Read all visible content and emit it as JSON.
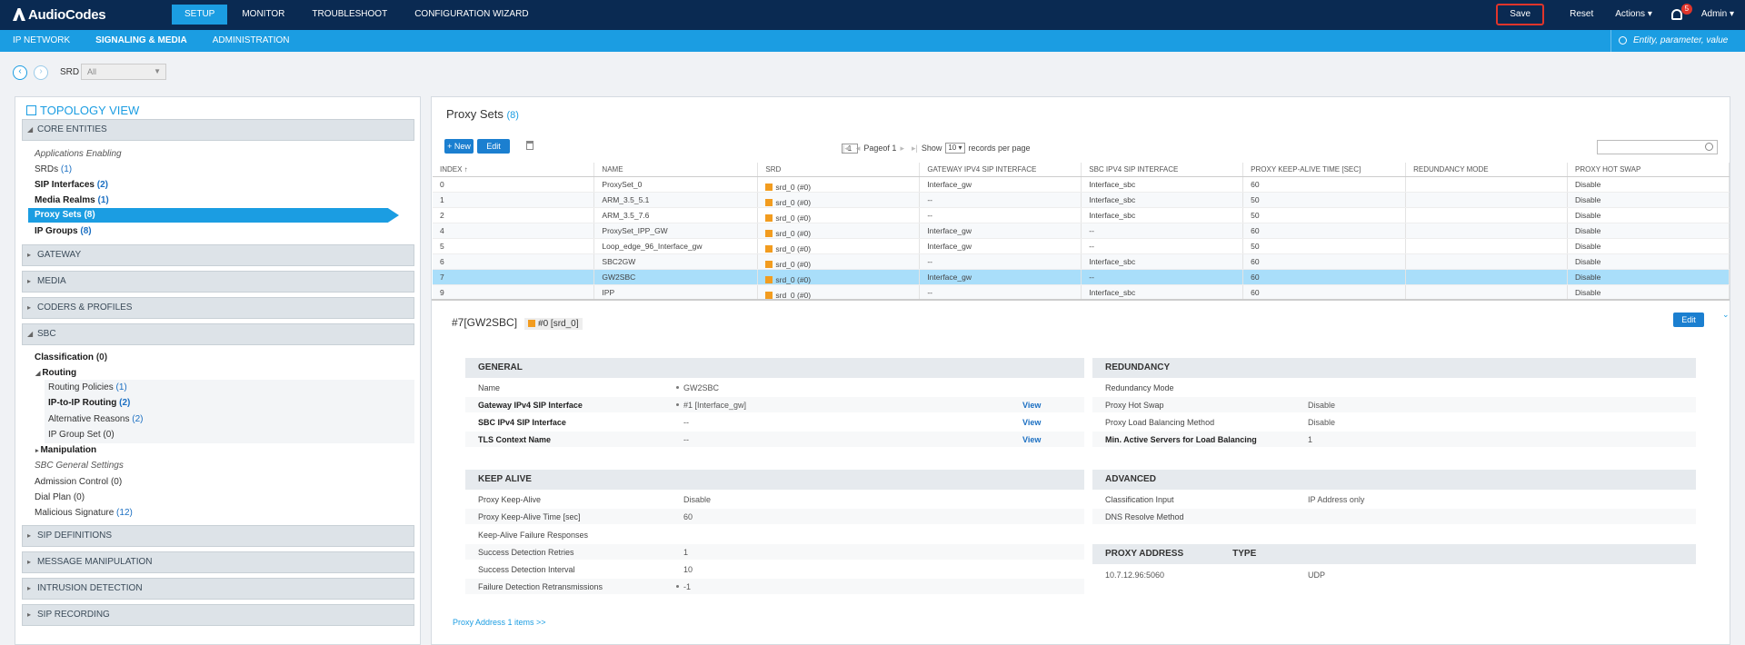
{
  "brand": "AudioCodes",
  "top_nav": [
    "SETUP",
    "MONITOR",
    "TROUBLESHOOT",
    "CONFIGURATION WIZARD"
  ],
  "top_right": {
    "save": "Save",
    "reset": "Reset",
    "actions": "Actions ▾",
    "notifications": "5",
    "user": "Admin ▾"
  },
  "sub_nav": [
    "IP NETWORK",
    "SIGNALING & MEDIA",
    "ADMINISTRATION"
  ],
  "search_placeholder": "Entity, parameter, value",
  "srd": {
    "label": "SRD",
    "value": "All"
  },
  "topology": {
    "title": "TOPOLOGY VIEW",
    "sections": {
      "core": "CORE ENTITIES",
      "gateway": "GATEWAY",
      "media": "MEDIA",
      "codecs": "CODERS & PROFILES",
      "sbc": "SBC",
      "sipdef": "SIP DEFINITIONS",
      "msgman": "MESSAGE MANIPULATION",
      "intrusion": "INTRUSION DETECTION",
      "siprec": "SIP RECORDING"
    },
    "core_items": {
      "app_enabling": "Applications Enabling",
      "srds": "SRDs",
      "srds_cnt": "(1)",
      "sip_interfaces": "SIP Interfaces",
      "sip_interfaces_cnt": "(2)",
      "media_realms": "Media Realms",
      "media_realms_cnt": "(1)",
      "proxy_sets": "Proxy Sets (8)",
      "ip_groups": "IP Groups",
      "ip_groups_cnt": "(8)"
    },
    "sbc_items": {
      "classification": "Classification",
      "classification_cnt": "(0)",
      "routing": "Routing",
      "routing_policies": "Routing Policies",
      "routing_policies_cnt": "(1)",
      "ip_to_ip": "IP-to-IP Routing",
      "ip_to_ip_cnt": "(2)",
      "alt_reasons": "Alternative Reasons",
      "alt_reasons_cnt": "(2)",
      "ip_group_set": "IP Group Set",
      "ip_group_set_cnt": "(0)",
      "manipulation": "Manipulation",
      "general_settings": "SBC General Settings",
      "admission": "Admission Control",
      "admission_cnt": "(0)",
      "dial_plan": "Dial Plan",
      "dial_plan_cnt": "(0)",
      "malicious": "Malicious Signature",
      "malicious_cnt": "(12)"
    }
  },
  "proxy_sets": {
    "title": "Proxy Sets",
    "count": "(8)",
    "buttons": {
      "new": "+ New",
      "edit": "Edit"
    },
    "pager": {
      "page_label": "Page",
      "page": "1",
      "of": "of 1",
      "show": "Show",
      "per_page": "10",
      "records": "records per page"
    },
    "columns": [
      "INDEX ↑",
      "NAME",
      "SRD",
      "GATEWAY IPV4 SIP INTERFACE",
      "SBC IPV4 SIP INTERFACE",
      "PROXY KEEP-ALIVE TIME [SEC]",
      "REDUNDANCY MODE",
      "PROXY HOT SWAP"
    ],
    "rows": [
      [
        "0",
        "ProxySet_0",
        "srd_0 (#0)",
        "Interface_gw",
        "Interface_sbc",
        "60",
        "",
        "Disable"
      ],
      [
        "1",
        "ARM_3.5_5.1",
        "srd_0 (#0)",
        "--",
        "Interface_sbc",
        "50",
        "",
        "Disable"
      ],
      [
        "2",
        "ARM_3.5_7.6",
        "srd_0 (#0)",
        "--",
        "Interface_sbc",
        "50",
        "",
        "Disable"
      ],
      [
        "4",
        "ProxySet_IPP_GW",
        "srd_0 (#0)",
        "Interface_gw",
        "--",
        "60",
        "",
        "Disable"
      ],
      [
        "5",
        "Loop_edge_96_Interface_gw",
        "srd_0 (#0)",
        "Interface_gw",
        "--",
        "50",
        "",
        "Disable"
      ],
      [
        "6",
        "SBC2GW",
        "srd_0 (#0)",
        "--",
        "Interface_sbc",
        "60",
        "",
        "Disable"
      ],
      [
        "7",
        "GW2SBC",
        "srd_0 (#0)",
        "Interface_gw",
        "--",
        "60",
        "",
        "Disable"
      ],
      [
        "9",
        "IPP",
        "srd_0 (#0)",
        "--",
        "Interface_sbc",
        "60",
        "",
        "Disable"
      ]
    ],
    "selected_row": 6
  },
  "detail": {
    "title": "#7[GW2SBC]",
    "srd_badge": "#0 [srd_0]",
    "edit": "Edit",
    "general": {
      "head": "GENERAL",
      "name_k": "Name",
      "name_v": "GW2SBC",
      "gw_k": "Gateway IPv4 SIP Interface",
      "gw_v": "#1 [Interface_gw]",
      "sbc_k": "SBC IPv4 SIP Interface",
      "sbc_v": "--",
      "tls_k": "TLS Context Name",
      "tls_v": "--",
      "view": "View"
    },
    "redundancy": {
      "head": "REDUNDANCY",
      "mode_k": "Redundancy Mode",
      "mode_v": "",
      "hot_k": "Proxy Hot Swap",
      "hot_v": "Disable",
      "lb_k": "Proxy Load Balancing Method",
      "lb_v": "Disable",
      "min_k": "Min. Active Servers for Load Balancing",
      "min_v": "1"
    },
    "keepalive": {
      "head": "KEEP ALIVE",
      "ka_k": "Proxy Keep-Alive",
      "ka_v": "Disable",
      "kat_k": "Proxy Keep-Alive Time [sec]",
      "kat_v": "60",
      "kaf_k": "Keep-Alive Failure Responses",
      "kaf_v": "",
      "sdr_k": "Success Detection Retries",
      "sdr_v": "1",
      "sdi_k": "Success Detection Interval",
      "sdi_v": "10",
      "fdr_k": "Failure Detection Retransmissions",
      "fdr_v": "-1"
    },
    "advanced": {
      "head": "ADVANCED",
      "ci_k": "Classification Input",
      "ci_v": "IP Address only",
      "dns_k": "DNS Resolve Method",
      "dns_v": ""
    },
    "proxy_address": {
      "head_addr": "PROXY ADDRESS",
      "head_type": "TYPE",
      "addr": "10.7.12.96:5060",
      "type": "UDP"
    },
    "link": "Proxy Address 1 items >>"
  },
  "colors": {
    "topbar": "#0a2a52",
    "accent": "#1b9de2",
    "selected_row": "#a9defa",
    "srd_square": "#f29c1f",
    "save_border": "#e0352b"
  }
}
